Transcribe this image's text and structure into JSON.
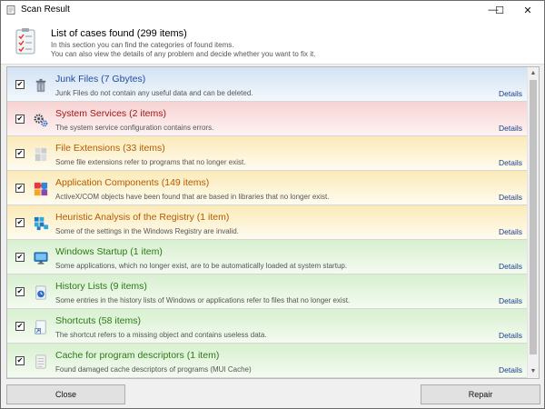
{
  "window": {
    "title": "Scan Result",
    "minimize_glyph": "—",
    "maximize_glyph": "☐",
    "close_glyph": "✕"
  },
  "header": {
    "title": "List of cases found (299 items)",
    "line1": "In this section you can find the categories of found items.",
    "line2": "You can also view the details of any problem and decide whether you want to fix it."
  },
  "items": [
    {
      "title": "Junk Files (7 Gbytes)",
      "description": "Junk Files do not contain any useful data and can be deleted.",
      "details": "Details",
      "checked": true,
      "icon": "trash-bin-icon",
      "color": "#1f4e9c",
      "bg_top": "#d2e2f3",
      "bg_bottom": "#f3f8fd"
    },
    {
      "title": "System Services (2 items)",
      "description": "The system service configuration contains errors.",
      "details": "Details",
      "checked": true,
      "icon": "gears-icon",
      "color": "#a01818",
      "bg_top": "#f7d3d3",
      "bg_bottom": "#fdf2f2"
    },
    {
      "title": "File Extensions (33 items)",
      "description": "Some file extensions refer to programs that no longer exist.",
      "details": "Details",
      "checked": true,
      "icon": "file-extension-icon",
      "color": "#b35a00",
      "bg_top": "#fbeab8",
      "bg_bottom": "#fffcf0"
    },
    {
      "title": "Application Components (149 items)",
      "description": "ActiveX/COM objects have been found that are based in libraries that no longer exist.",
      "details": "Details",
      "checked": true,
      "icon": "puzzle-icon",
      "color": "#b35a00",
      "bg_top": "#fbeab8",
      "bg_bottom": "#fffcf0"
    },
    {
      "title": "Heuristic Analysis of the Registry (1 item)",
      "description": "Some of the settings in the Windows Registry are invalid.",
      "details": "Details",
      "checked": true,
      "icon": "registry-blocks-icon",
      "color": "#b35a00",
      "bg_top": "#fbeab8",
      "bg_bottom": "#fffcf0"
    },
    {
      "title": "Windows Startup (1 item)",
      "description": "Some applications, which no longer exist, are to be automatically loaded at system startup.",
      "details": "Details",
      "checked": true,
      "icon": "monitor-icon",
      "color": "#2b7a16",
      "bg_top": "#d8f0d0",
      "bg_bottom": "#f4fbf1"
    },
    {
      "title": "History Lists (9 items)",
      "description": "Some entries in the history lists of Windows or applications refer to files that no longer exist.",
      "details": "Details",
      "checked": true,
      "icon": "history-document-icon",
      "color": "#2b7a16",
      "bg_top": "#d8f0d0",
      "bg_bottom": "#f4fbf1"
    },
    {
      "title": "Shortcuts (58 items)",
      "description": "The shortcut refers to a missing object and contains useless data.",
      "details": "Details",
      "checked": true,
      "icon": "shortcut-icon",
      "color": "#2b7a16",
      "bg_top": "#d8f0d0",
      "bg_bottom": "#f4fbf1"
    },
    {
      "title": "Cache for program descriptors (1 item)",
      "description": "Found damaged cache descriptors of programs (MUI Cache)",
      "details": "Details",
      "checked": true,
      "icon": "cache-document-icon",
      "color": "#2b7a16",
      "bg_top": "#d8f0d0",
      "bg_bottom": "#f4fbf1"
    }
  ],
  "scrollbar": {
    "up_glyph": "▲",
    "down_glyph": "▼"
  },
  "buttons": {
    "close": "Close",
    "repair": "Repair"
  },
  "check_glyph": "✔"
}
